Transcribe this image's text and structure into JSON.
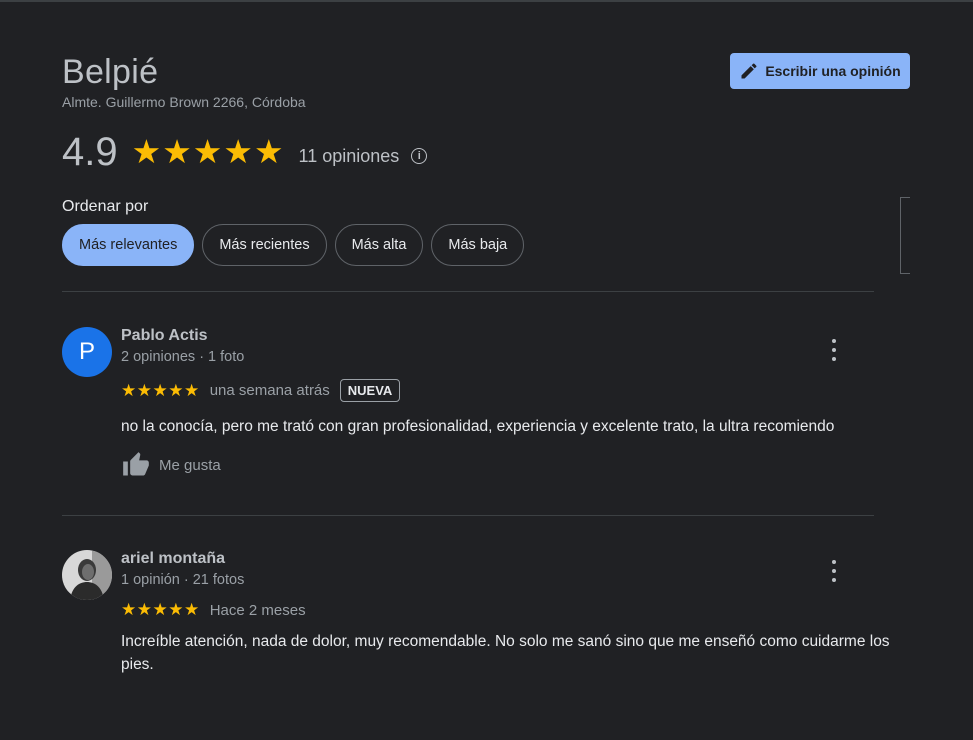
{
  "place": {
    "name": "Belpié",
    "address": "Almte. Guillermo Brown 2266, Córdoba"
  },
  "write_button": {
    "label": "Escribir una opinión",
    "icon": "pencil-icon"
  },
  "summary": {
    "rating": "4.9",
    "stars": "★★★★★",
    "count": "11 opiniones",
    "info_icon": "i"
  },
  "sort": {
    "label": "Ordenar por",
    "options": [
      "Más relevantes",
      "Más recientes",
      "Más alta",
      "Más baja"
    ],
    "selected": "Más relevantes"
  },
  "reviews": [
    {
      "avatar_letter": "P",
      "name": "Pablo Actis",
      "meta": "2 opiniones · 1 foto",
      "stars": "★★★★★",
      "time": "una semana atrás",
      "badge": "NUEVA",
      "text": "no la conocía, pero me trató con gran profesionalidad,  experiencia y excelente trato, la ultra recomiendo",
      "like_label": "Me gusta"
    },
    {
      "avatar_letter": "",
      "name": "ariel montaña",
      "meta": "1 opinión · 21 fotos",
      "stars": "★★★★★",
      "time": "Hace 2 meses",
      "text": "Increíble atención, nada de dolor, muy recomendable. No solo me sanó sino que me enseñó como cuidarme los pies."
    }
  ],
  "colors": {
    "background": "#202124",
    "accent": "#8ab4f8",
    "star": "#fbbc04",
    "avatar_blue": "#1a73e8"
  }
}
